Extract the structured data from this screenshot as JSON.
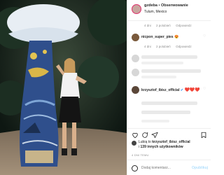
{
  "post": {
    "username": "gzdeba",
    "separator": "•",
    "follow_label": "Obserwowanie",
    "location": "Tulum, Mexico"
  },
  "comments": [
    {
      "meta": {
        "time": "4 dni",
        "likes": "2 polubień",
        "reply": "Odpowiedz"
      }
    },
    {
      "username": "nicpon_super_pies",
      "emoji": "😍",
      "meta": {
        "time": "4 dni",
        "likes": "2 polubień",
        "reply": "Odpowiedz"
      }
    },
    {
      "username": "krzysztof_ibisz_official",
      "verified": "✔",
      "text": "❤️❤️❤️"
    }
  ],
  "actions": {
    "like": "heart-icon",
    "comment": "comment-icon",
    "share": "share-icon",
    "save": "bookmark-icon"
  },
  "likes": {
    "prefix": "Lubią to",
    "user": "krzysztof_ibisz_official",
    "middle": "i",
    "count": "139 innych użytkowników"
  },
  "timestamp": "4 DNI TEMU",
  "add_comment": {
    "placeholder": "Dodaj komentarz...",
    "publish_label": "Opublikuj"
  }
}
